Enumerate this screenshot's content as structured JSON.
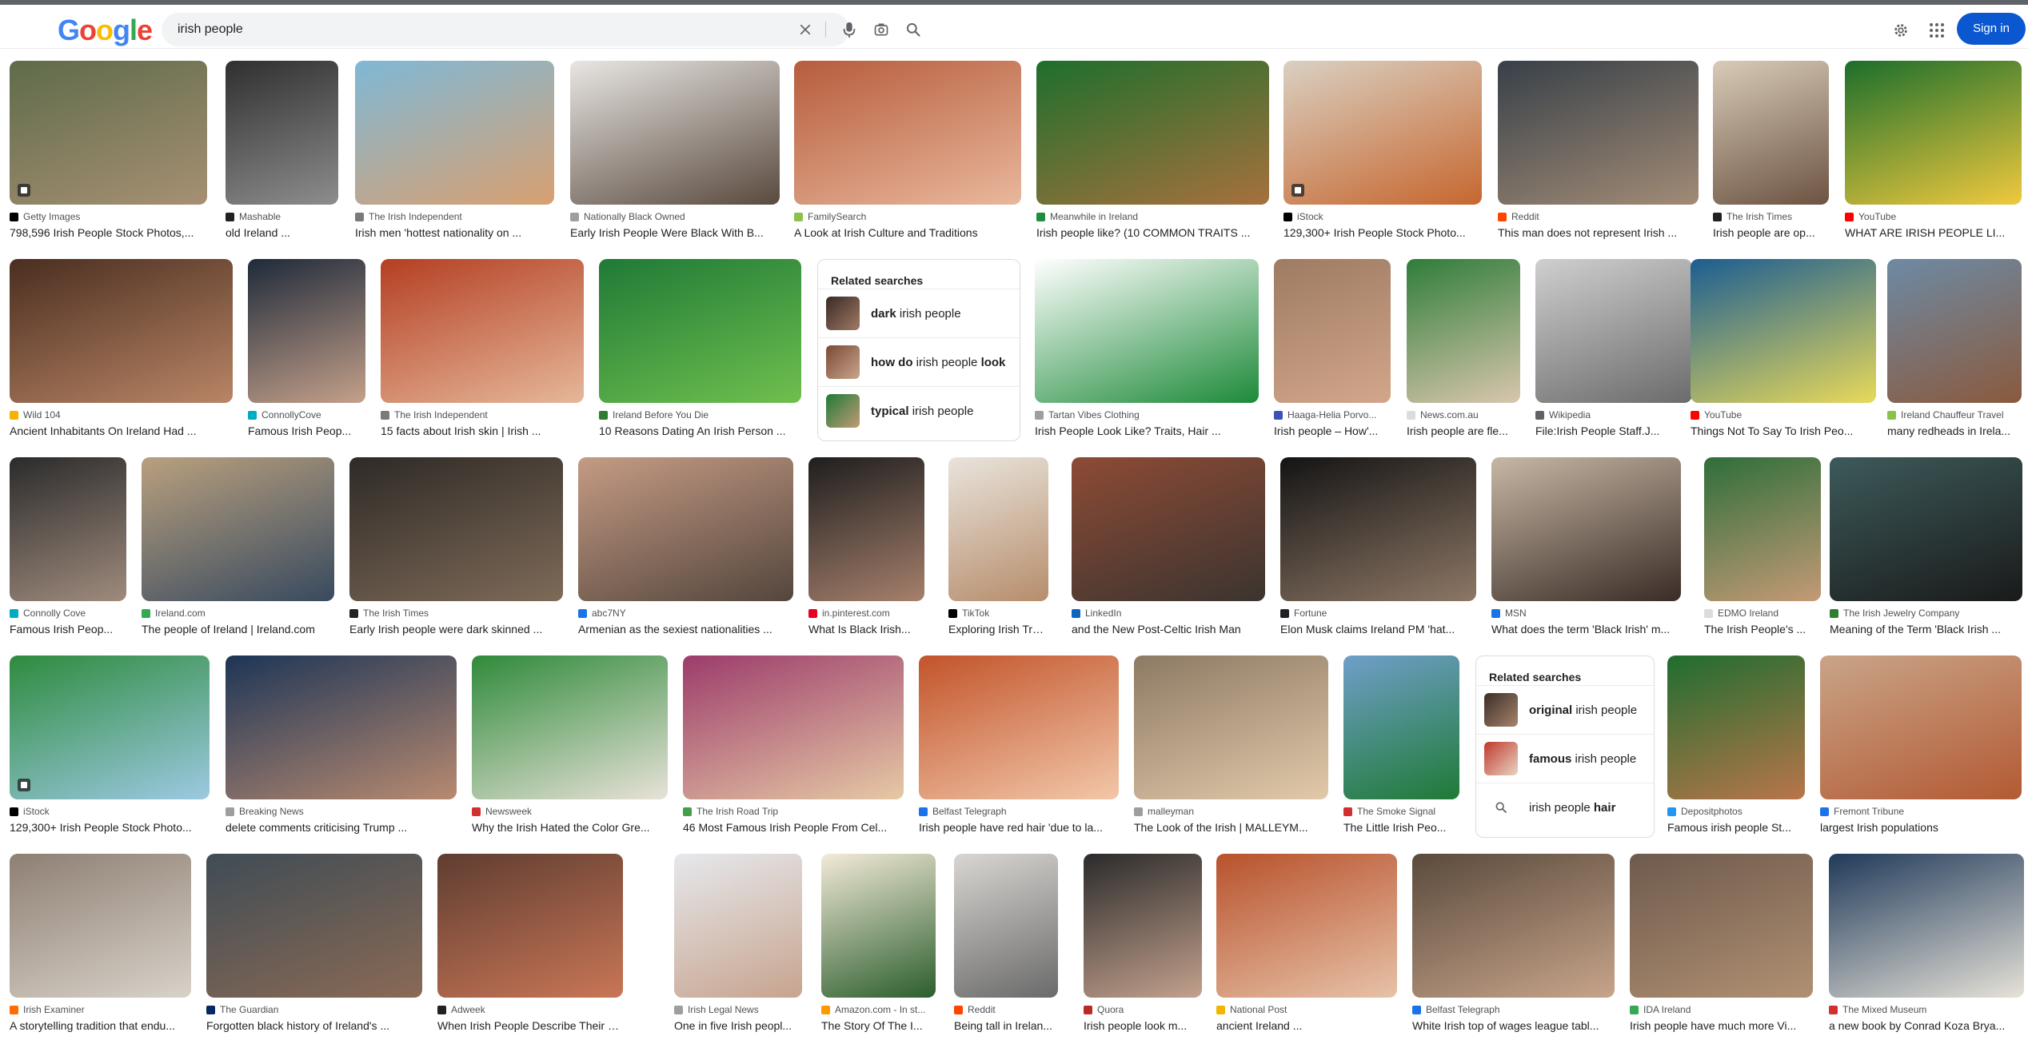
{
  "header": {
    "logo_letters": [
      "G",
      "o",
      "o",
      "g",
      "l",
      "e"
    ],
    "logo_colors": [
      "#4285f4",
      "#ea4335",
      "#fbbc05",
      "#4285f4",
      "#34a853",
      "#ea4335"
    ],
    "search_value": "irish people",
    "sign_in_label": "Sign in",
    "accent_color": "#0b57d0"
  },
  "icons": {
    "clear": "close-icon",
    "voice": "microphone-icon",
    "lens": "camera-lens-icon",
    "search": "search-icon",
    "settings": "gear-icon",
    "apps": "apps-grid-icon"
  },
  "rows": [
    [
      {
        "source": "Getty Images",
        "title": "798,596 Irish People Stock Photos,...",
        "fav": "#000000",
        "bg": [
          "#5e6b4a",
          "#a79073"
        ],
        "badge": true
      },
      {
        "source": "Mashable",
        "title": "old Ireland ...",
        "fav": "#202124",
        "bg": [
          "#2f2f2f",
          "#8d8d8d"
        ]
      },
      {
        "source": "The Irish Independent",
        "title": "Irish men 'hottest nationality on ...",
        "fav": "#7a7a7a",
        "bg": [
          "#7fb8d6",
          "#d8a071"
        ]
      },
      {
        "source": "Nationally Black Owned",
        "title": "Early Irish People Were Black With B...",
        "fav": "#9e9e9e",
        "bg": [
          "#e8e6e3",
          "#5a4a3e"
        ]
      },
      {
        "source": "FamilySearch",
        "title": "A Look at Irish Culture and Traditions",
        "fav": "#8bc34a",
        "bg": [
          "#b65d3c",
          "#e9b79c"
        ]
      },
      {
        "source": "Meanwhile in Ireland",
        "title": "Irish people like? (10 COMMON TRAITS ...",
        "fav": "#1e8e3e",
        "bg": [
          "#1e6f2c",
          "#a7703d"
        ]
      },
      {
        "source": "iStock",
        "title": "129,300+ Irish People Stock Photo...",
        "fav": "#000000",
        "bg": [
          "#d9d0c2",
          "#c7672f"
        ],
        "badge": true
      },
      {
        "source": "Reddit",
        "title": "This man does not represent Irish ...",
        "fav": "#ff4500",
        "bg": [
          "#374048",
          "#a28b76"
        ]
      },
      {
        "source": "The Irish Times",
        "title": "Irish people are op...",
        "fav": "#202124",
        "bg": [
          "#d8cbb8",
          "#6c5342"
        ]
      },
      {
        "source": "YouTube",
        "title": "WHAT ARE IRISH PEOPLE LI...",
        "fav": "#ff0000",
        "bg": [
          "#1b6e2b",
          "#f0c93e"
        ]
      }
    ],
    [
      {
        "source": "Wild 104",
        "title": "Ancient Inhabitants On Ireland Had ...",
        "fav": "#f4b400",
        "bg": [
          "#4a2e20",
          "#b98565"
        ]
      },
      {
        "source": "ConnollyCove",
        "title": "Famous Irish Peop...",
        "fav": "#00acc1",
        "bg": [
          "#1f2a3a",
          "#c4a08a"
        ]
      },
      {
        "source": "The Irish Independent",
        "title": "15 facts about Irish skin | Irish ...",
        "fav": "#7a7a7a",
        "bg": [
          "#b43f22",
          "#e6b79a"
        ]
      },
      {
        "source": "Ireland Before You Die",
        "title": "10 Reasons Dating An Irish Person ...",
        "fav": "#2e7d32",
        "bg": [
          "#1f7a36",
          "#6fbf4e"
        ]
      },
      {
        "related": true
      },
      {
        "source": "Tartan Vibes Clothing",
        "title": "Irish People Look Like? Traits, Hair ...",
        "fav": "#9e9e9e",
        "bg": [
          "#ffffff",
          "#1d8a39"
        ]
      },
      {
        "source": "Haaga-Helia Porvo...",
        "title": "Irish people – How'...",
        "fav": "#3f51b5",
        "bg": [
          "#9d7b62",
          "#d3a68b"
        ]
      },
      {
        "source": "News.com.au",
        "title": "Irish people are fle...",
        "fav": "#dadce0",
        "bg": [
          "#2f7d3a",
          "#d9c6ad"
        ]
      },
      {
        "source": "Wikipedia",
        "title": "File:Irish People Staff.J...",
        "fav": "#5f6368",
        "bg": [
          "#cfcfcf",
          "#6b6b6b"
        ]
      },
      {
        "source": "YouTube",
        "title": "Things Not To Say To Irish Peo...",
        "fav": "#ff0000",
        "bg": [
          "#1b5d91",
          "#e8d95a"
        ]
      },
      {
        "source": "Ireland Chauffeur Travel",
        "title": "many redheads in Irela...",
        "fav": "#8bc34a",
        "bg": [
          "#6d8aa4",
          "#8a5a3e"
        ]
      }
    ],
    [
      {
        "source": "Connolly Cove",
        "title": "Famous Irish Peop...",
        "fav": "#00acc1",
        "bg": [
          "#2b2b2b",
          "#9f8b7d"
        ]
      },
      {
        "source": "Ireland.com",
        "title": "The people of Ireland | Ireland.com",
        "fav": "#34a853",
        "bg": [
          "#b9a07e",
          "#384a5f"
        ]
      },
      {
        "source": "The Irish Times",
        "title": "Early Irish people were dark skinned ...",
        "fav": "#202124",
        "bg": [
          "#2e2a26",
          "#7e6a58"
        ]
      },
      {
        "source": "abc7NY",
        "title": "Armenian as the sexiest nationalities ...",
        "fav": "#1a73e8",
        "bg": [
          "#c59b84",
          "#54463d"
        ]
      },
      {
        "source": "in.pinterest.com",
        "title": "What Is Black Irish...",
        "fav": "#e60023",
        "bg": [
          "#1e1e1e",
          "#a6806c"
        ]
      },
      {
        "source": "TikTok",
        "title": "Exploring Irish Trai...",
        "fav": "#000000",
        "bg": [
          "#e9e4dc",
          "#b68d6b"
        ]
      },
      {
        "source": "LinkedIn",
        "title": "and the New Post-Celtic Irish Man",
        "fav": "#0a66c2",
        "bg": [
          "#8d4b35",
          "#3b3430"
        ]
      },
      {
        "source": "Fortune",
        "title": "Elon Musk claims Ireland PM 'hat...",
        "fav": "#202124",
        "bg": [
          "#141414",
          "#8d7765"
        ]
      },
      {
        "source": "MSN",
        "title": "What does the term 'Black Irish' m...",
        "fav": "#1a73e8",
        "bg": [
          "#c7b7a5",
          "#3a2c26"
        ]
      },
      {
        "source": "EDMO Ireland",
        "title": "The Irish People's ...",
        "fav": "#dadce0",
        "bg": [
          "#2e6e3a",
          "#c49a76"
        ]
      },
      {
        "source": "The Irish Jewelry Company",
        "title": "Meaning of the Term 'Black Irish ...",
        "fav": "#2e7d32",
        "bg": [
          "#3d5a5a",
          "#1a1a1a"
        ]
      }
    ],
    [
      {
        "source": "iStock",
        "title": "129,300+ Irish People Stock Photo...",
        "fav": "#000000",
        "bg": [
          "#2e8b3e",
          "#9cc9e2"
        ],
        "badge": true
      },
      {
        "source": "Breaking News",
        "title": "delete comments criticising Trump ...",
        "fav": "#9e9e9e",
        "bg": [
          "#1d3556",
          "#b88a70"
        ]
      },
      {
        "source": "Newsweek",
        "title": "Why the Irish Hated the Color Gre...",
        "fav": "#d32f2f",
        "bg": [
          "#2f8a3a",
          "#e8e2d8"
        ]
      },
      {
        "source": "The Irish Road Trip",
        "title": "46 Most Famous Irish People From Cel...",
        "fav": "#43a047",
        "bg": [
          "#9c3c6b",
          "#e6c9a5"
        ]
      },
      {
        "source": "Belfast Telegraph",
        "title": "Irish people have red hair 'due to la...",
        "fav": "#1a73e8",
        "bg": [
          "#c2542b",
          "#f2c7a9"
        ]
      },
      {
        "source": "malleyman",
        "title": "The Look of the Irish | MALLEYM...",
        "fav": "#9e9e9e",
        "bg": [
          "#8d7a64",
          "#e2c9aa"
        ]
      },
      {
        "source": "The Smoke Signal",
        "title": "The Little Irish Peo...",
        "fav": "#d32f2f",
        "bg": [
          "#6f9fc9",
          "#1f7a36"
        ]
      },
      {
        "related": true
      },
      {
        "source": "Depositphotos",
        "title": "Famous irish people St...",
        "fav": "#2196f3",
        "bg": [
          "#1f6d2f",
          "#b9754a"
        ]
      },
      {
        "source": "Fremont Tribune",
        "title": "largest Irish populations",
        "fav": "#1a73e8",
        "bg": [
          "#c9a488",
          "#b35a33"
        ]
      }
    ],
    [
      {
        "source": "Irish Examiner",
        "title": "A storytelling tradition that endu...",
        "fav": "#ff6d00",
        "bg": [
          "#8e7f73",
          "#d8d2c9"
        ]
      },
      {
        "source": "The Guardian",
        "title": "Forgotten black history of Ireland's ...",
        "fav": "#052962",
        "bg": [
          "#3f4c55",
          "#8a6a55"
        ]
      },
      {
        "source": "Adweek",
        "title": "When Irish People Describe Their First ...",
        "fav": "#202124",
        "bg": [
          "#5f3d31",
          "#c97656"
        ]
      },
      {
        "source": "Irish Legal News",
        "title": "One in five Irish peopl...",
        "fav": "#9e9e9e",
        "bg": [
          "#e6e8ec",
          "#c7a48e"
        ]
      },
      {
        "source": "Amazon.com - In st...",
        "title": "The Story Of The I...",
        "fav": "#ff9900",
        "bg": [
          "#f2ead7",
          "#2c5e2e"
        ]
      },
      {
        "source": "Reddit",
        "title": "Being tall in Irelan...",
        "fav": "#ff4500",
        "bg": [
          "#d9d6d2",
          "#6a6a6a"
        ]
      },
      {
        "source": "Quora",
        "title": "Irish people look m...",
        "fav": "#b92b27",
        "bg": [
          "#2b2b2b",
          "#c3a18d"
        ]
      },
      {
        "source": "National Post",
        "title": "ancient Ireland ...",
        "fav": "#f4b400",
        "bg": [
          "#b8522c",
          "#e7c2a8"
        ]
      },
      {
        "source": "Belfast Telegraph",
        "title": "White Irish top of wages league tabl...",
        "fav": "#1a73e8",
        "bg": [
          "#5a4a3c",
          "#c7a48a"
        ]
      },
      {
        "source": "IDA Ireland",
        "title": "Irish people have much more Vi...",
        "fav": "#34a853",
        "bg": [
          "#6e5a4d",
          "#b09072"
        ]
      },
      {
        "source": "The Mixed Museum",
        "title": "a new book by Conrad Koza Brya...",
        "fav": "#d32f2f",
        "bg": [
          "#203a5a",
          "#e6e2d8"
        ]
      }
    ]
  ],
  "related_searches": [
    {
      "heading": "Related searches",
      "items": [
        {
          "bold": "dark",
          "rest": " irish people",
          "thumb": [
            "#3a2a24",
            "#a07a64"
          ]
        },
        {
          "bold": "how do",
          "rest": " irish people ",
          "bold2": "look",
          "thumb": [
            "#7a4a36",
            "#c9a58c"
          ]
        },
        {
          "bold": "typical",
          "rest": " irish people",
          "thumb": [
            "#1f7a36",
            "#c49a76"
          ]
        }
      ]
    },
    {
      "heading": "Related searches",
      "items": [
        {
          "bold": "original",
          "rest": " irish people",
          "thumb": [
            "#3b2e28",
            "#a7846b"
          ]
        },
        {
          "bold": "famous",
          "rest": " irish people",
          "thumb": [
            "#c0392b",
            "#e8d5c4"
          ]
        },
        {
          "pre": "irish people ",
          "bold": "hair",
          "search_icon": true
        }
      ]
    }
  ]
}
